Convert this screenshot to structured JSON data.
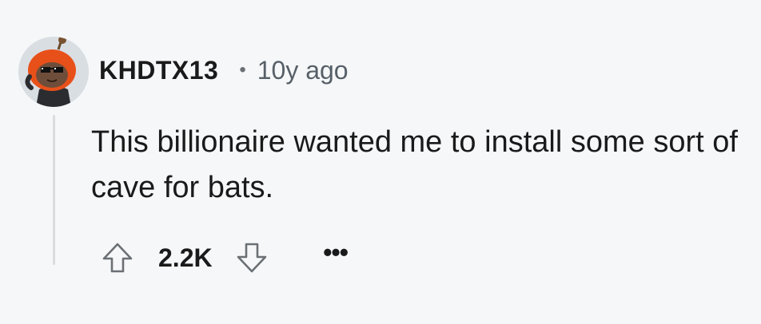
{
  "comment": {
    "avatar_icon": "snoo-avatar-orange-hood-sunglasses",
    "username": "KHDTX13",
    "separator": "•",
    "timestamp": "10y ago",
    "body": "This billionaire wanted me to install some sort of cave for bats.",
    "actions": {
      "upvote_icon": "arrow-up-icon",
      "score": "2.2K",
      "downvote_icon": "arrow-down-icon",
      "more_label": "•••"
    }
  },
  "colors": {
    "background": "#f6f7f8",
    "avatar_hood": "#e8501a",
    "text": "#1a1a1b",
    "muted": "#576069",
    "thread_line": "#dadde0"
  }
}
